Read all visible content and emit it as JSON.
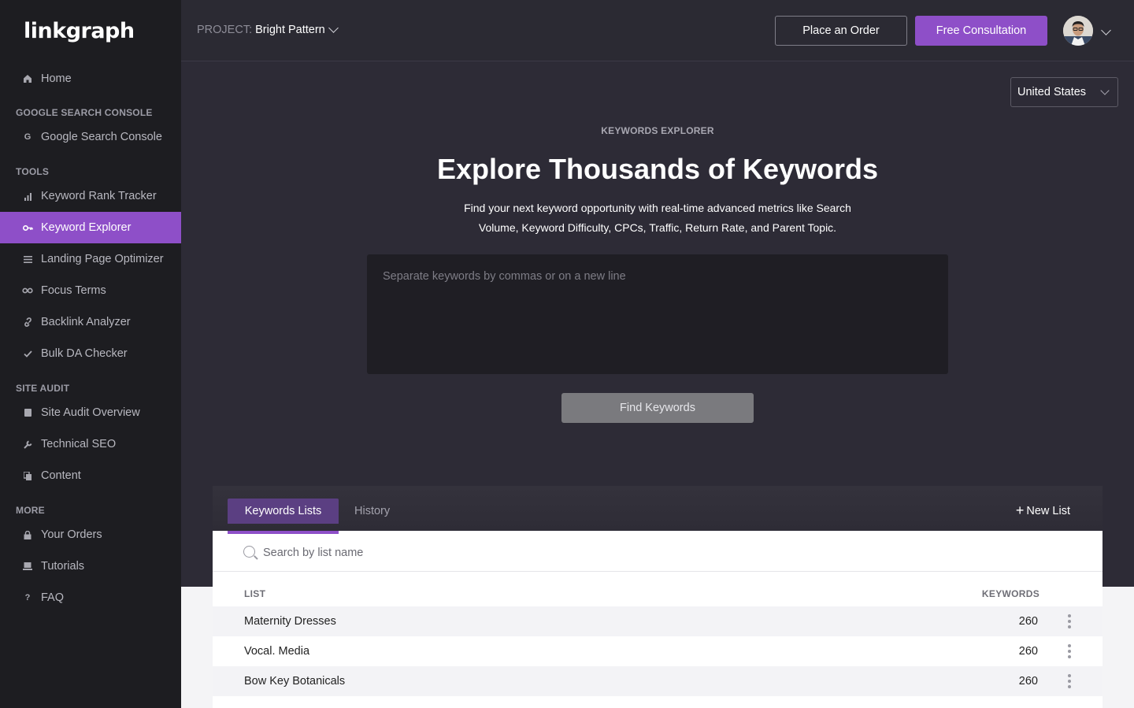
{
  "app": {
    "logo": "linkgraph"
  },
  "sidebar": {
    "home": {
      "label": "Home",
      "icon": "home-icon"
    },
    "sections": [
      {
        "title": "GOOGLE SEARCH CONSOLE",
        "items": [
          {
            "label": "Google Search Console",
            "icon": "google-icon"
          }
        ]
      },
      {
        "title": "TOOLS",
        "items": [
          {
            "label": "Keyword Rank Tracker",
            "icon": "bar-chart-icon"
          },
          {
            "label": "Keyword Explorer",
            "icon": "key-icon",
            "active": true
          },
          {
            "label": "Landing Page Optimizer",
            "icon": "list-icon"
          },
          {
            "label": "Focus Terms",
            "icon": "infinity-icon"
          },
          {
            "label": "Backlink Analyzer",
            "icon": "link-icon"
          },
          {
            "label": "Bulk DA Checker",
            "icon": "check-icon"
          }
        ]
      },
      {
        "title": "SITE AUDIT",
        "items": [
          {
            "label": "Site Audit Overview",
            "icon": "square-icon"
          },
          {
            "label": "Technical SEO",
            "icon": "wrench-icon"
          },
          {
            "label": "Content",
            "icon": "copy-icon"
          }
        ]
      },
      {
        "title": "MORE",
        "items": [
          {
            "label": "Your Orders",
            "icon": "lock-icon"
          },
          {
            "label": "Tutorials",
            "icon": "laptop-icon"
          },
          {
            "label": "FAQ",
            "icon": "question-icon"
          }
        ]
      }
    ]
  },
  "header": {
    "project_prefix": "PROJECT:",
    "project_name": "Bright Pattern",
    "place_order": "Place an Order",
    "free_consultation": "Free Consultation"
  },
  "main": {
    "country": "United States",
    "eyebrow": "KEYWORDS EXPLORER",
    "headline": "Explore Thousands of Keywords",
    "subtitle": "Find your next keyword opportunity with real-time advanced metrics like Search Volume, Keyword Difficulty, CPCs, Traffic, Return Rate, and Parent Topic.",
    "input_placeholder": "Separate keywords by commas or on a new line",
    "find_button": "Find Keywords"
  },
  "lists": {
    "tabs": [
      "Keywords Lists",
      "History"
    ],
    "new_list": "New List",
    "search_placeholder": "Search by list name",
    "columns": {
      "list": "LIST",
      "keywords": "KEYWORDS"
    },
    "rows": [
      {
        "name": "Maternity Dresses",
        "count": "260"
      },
      {
        "name": "Vocal. Media",
        "count": "260"
      },
      {
        "name": "Bow Key Botanicals",
        "count": "260"
      }
    ]
  },
  "colors": {
    "accent": "#8e4fc8",
    "sidebar": "#1d1d21",
    "main_bg": "#2d2b36"
  }
}
